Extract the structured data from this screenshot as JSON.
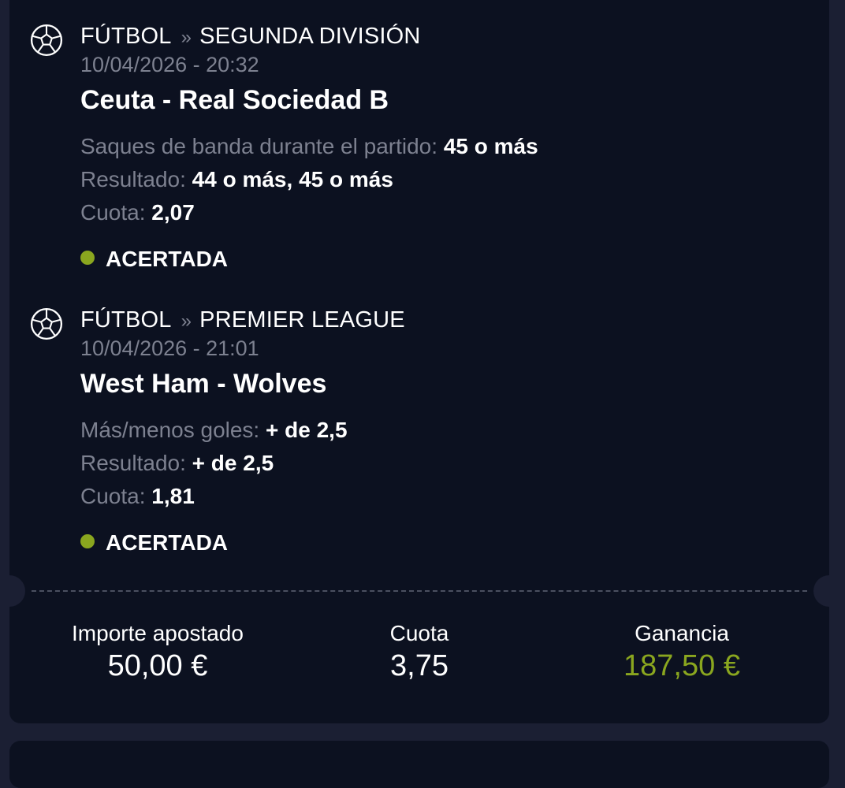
{
  "colors": {
    "page_bg": "#1b1f33",
    "card_bg": "#0c1120",
    "muted_text": "#7d8190",
    "success_green": "#8aa61f"
  },
  "bets": [
    {
      "sport_icon": "soccer-ball-icon",
      "sport": "FÚTBOL",
      "separator": "»",
      "league": "SEGUNDA DIVISIÓN",
      "datetime": "10/04/2026 - 20:32",
      "match": "Ceuta - Real Sociedad B",
      "market_label": "Saques de banda durante el partido:",
      "market_value": "45 o más",
      "result_label": "Resultado:",
      "result_value": "44 o más, 45 o más",
      "odds_label": "Cuota:",
      "odds_value": "2,07",
      "status": "ACERTADA"
    },
    {
      "sport_icon": "soccer-ball-icon",
      "sport": "FÚTBOL",
      "separator": "»",
      "league": "PREMIER LEAGUE",
      "datetime": "10/04/2026 - 21:01",
      "match": "West Ham - Wolves",
      "market_label": "Más/menos goles:",
      "market_value": "+ de 2,5",
      "result_label": "Resultado:",
      "result_value": "+ de 2,5",
      "odds_label": "Cuota:",
      "odds_value": "1,81",
      "status": "ACERTADA"
    }
  ],
  "summary": {
    "stake_label": "Importe apostado",
    "stake_value": "50,00 €",
    "odds_label": "Cuota",
    "odds_value": "3,75",
    "winnings_label": "Ganancia",
    "winnings_value": "187,50 €"
  }
}
